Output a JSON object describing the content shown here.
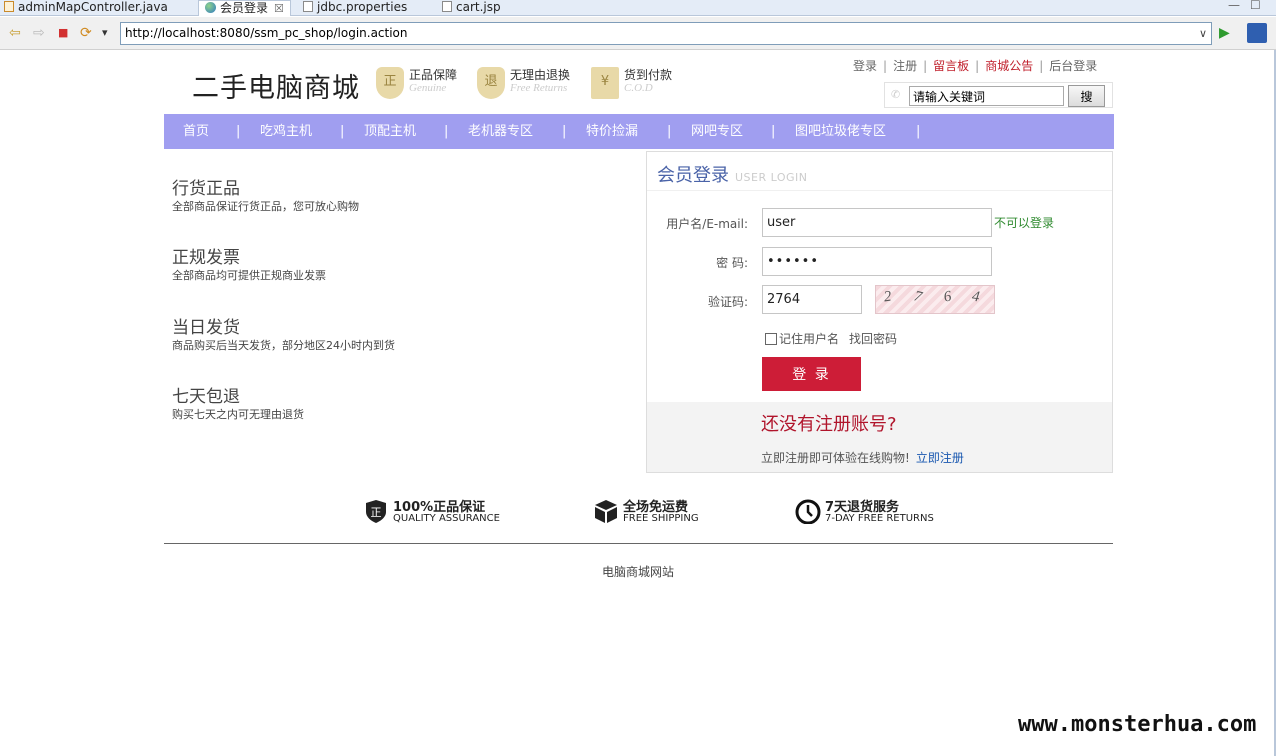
{
  "ide": {
    "tabs": [
      {
        "label": "adminMapController.java"
      },
      {
        "label": "会员登录",
        "close": "☒"
      },
      {
        "label": "jdbc.properties"
      },
      {
        "label": "cart.jsp"
      }
    ],
    "window_controls": {
      "minimize": "—",
      "maximize": "☐"
    }
  },
  "browser": {
    "back": "⇦",
    "forward": "⇨",
    "stop": "■",
    "refresh": "⟳",
    "menu": "▾",
    "url": "http://localhost:8080/ssm_pc_shop/login.action",
    "url_dropdown": "∨",
    "go": "▶"
  },
  "header": {
    "logo": "二手电脑商城",
    "badges": [
      {
        "icon_char": "正",
        "title": "正品保障",
        "subtitle": "Genuine"
      },
      {
        "icon_char": "退",
        "title": "无理由退换",
        "subtitle": "Free Returns"
      },
      {
        "icon_char": "¥",
        "title": "货到付款",
        "subtitle": "C.O.D"
      }
    ],
    "links": [
      {
        "label": "登录"
      },
      {
        "label": "注册"
      },
      {
        "label": "留言板"
      },
      {
        "label": "商城公告"
      },
      {
        "label": "后台登录"
      }
    ],
    "search": {
      "value": "请输入关键词",
      "button": "搜"
    }
  },
  "nav": {
    "items": [
      "首页",
      "吃鸡主机",
      "顶配主机",
      "老机器专区",
      "特价捡漏",
      "网吧专区",
      "图吧垃圾佬专区"
    ],
    "separator": "|"
  },
  "features": [
    {
      "title": "行货正品",
      "desc": "全部商品保证行货正品，您可放心购物"
    },
    {
      "title": "正规发票",
      "desc": "全部商品均可提供正规商业发票"
    },
    {
      "title": "当日发货",
      "desc": "商品购买后当天发货，部分地区24小时内到货"
    },
    {
      "title": "七天包退",
      "desc": "购买七天之内可无理由退货"
    }
  ],
  "login": {
    "title": "会员登录",
    "title_en": "USER LOGIN",
    "username_label": "用户名/E-mail:",
    "username_value": "user",
    "username_hint": "不可以登录",
    "password_label": "密  码:",
    "password_value": "••••••",
    "captcha_label": "验证码:",
    "captcha_value": "2764",
    "captcha_chars": [
      "2",
      "7",
      "6",
      "4"
    ],
    "remember_label": "记住用户名",
    "remember_checked": false,
    "find_password": "找回密码",
    "submit": "登 录",
    "register_prompt": "还没有注册账号?",
    "register_text": "立即注册即可体验在线购物!",
    "register_link": "立即注册"
  },
  "services": [
    {
      "icon": "shield-icon",
      "title": "100%正品保证",
      "subtitle": "QUALITY ASSURANCE"
    },
    {
      "icon": "box-icon",
      "title": "全场免运费",
      "subtitle": "FREE SHIPPING"
    },
    {
      "icon": "clock-icon",
      "title": "7天退货服务",
      "subtitle": "7-DAY FREE RETURNS"
    }
  ],
  "footer": {
    "text": "电脑商城网站"
  },
  "watermark": "www.monsterhua.com",
  "colors": {
    "nav": "#a09ef0",
    "login_button": "#cd1d37",
    "accent_red": "#c0202c",
    "link_blue": "#1a58b0"
  }
}
